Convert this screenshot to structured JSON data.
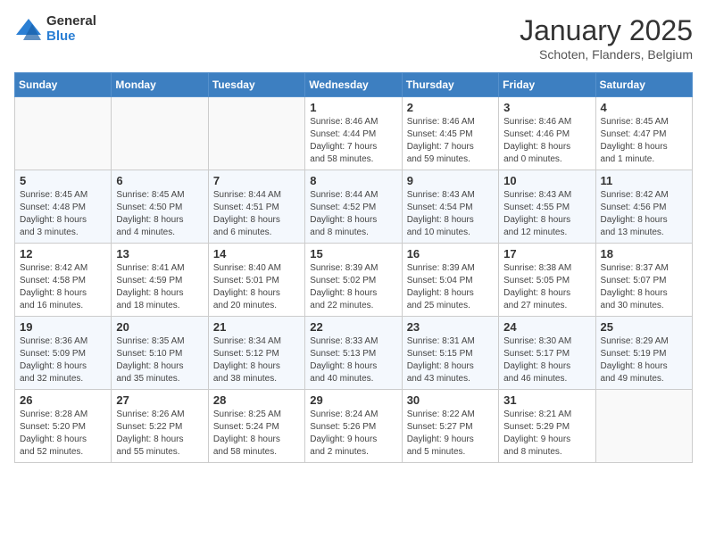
{
  "header": {
    "logo_general": "General",
    "logo_blue": "Blue",
    "month_title": "January 2025",
    "location": "Schoten, Flanders, Belgium"
  },
  "days_of_week": [
    "Sunday",
    "Monday",
    "Tuesday",
    "Wednesday",
    "Thursday",
    "Friday",
    "Saturday"
  ],
  "weeks": [
    {
      "days": [
        {
          "number": "",
          "info": ""
        },
        {
          "number": "",
          "info": ""
        },
        {
          "number": "",
          "info": ""
        },
        {
          "number": "1",
          "info": "Sunrise: 8:46 AM\nSunset: 4:44 PM\nDaylight: 7 hours\nand 58 minutes."
        },
        {
          "number": "2",
          "info": "Sunrise: 8:46 AM\nSunset: 4:45 PM\nDaylight: 7 hours\nand 59 minutes."
        },
        {
          "number": "3",
          "info": "Sunrise: 8:46 AM\nSunset: 4:46 PM\nDaylight: 8 hours\nand 0 minutes."
        },
        {
          "number": "4",
          "info": "Sunrise: 8:45 AM\nSunset: 4:47 PM\nDaylight: 8 hours\nand 1 minute."
        }
      ]
    },
    {
      "days": [
        {
          "number": "5",
          "info": "Sunrise: 8:45 AM\nSunset: 4:48 PM\nDaylight: 8 hours\nand 3 minutes."
        },
        {
          "number": "6",
          "info": "Sunrise: 8:45 AM\nSunset: 4:50 PM\nDaylight: 8 hours\nand 4 minutes."
        },
        {
          "number": "7",
          "info": "Sunrise: 8:44 AM\nSunset: 4:51 PM\nDaylight: 8 hours\nand 6 minutes."
        },
        {
          "number": "8",
          "info": "Sunrise: 8:44 AM\nSunset: 4:52 PM\nDaylight: 8 hours\nand 8 minutes."
        },
        {
          "number": "9",
          "info": "Sunrise: 8:43 AM\nSunset: 4:54 PM\nDaylight: 8 hours\nand 10 minutes."
        },
        {
          "number": "10",
          "info": "Sunrise: 8:43 AM\nSunset: 4:55 PM\nDaylight: 8 hours\nand 12 minutes."
        },
        {
          "number": "11",
          "info": "Sunrise: 8:42 AM\nSunset: 4:56 PM\nDaylight: 8 hours\nand 13 minutes."
        }
      ]
    },
    {
      "days": [
        {
          "number": "12",
          "info": "Sunrise: 8:42 AM\nSunset: 4:58 PM\nDaylight: 8 hours\nand 16 minutes."
        },
        {
          "number": "13",
          "info": "Sunrise: 8:41 AM\nSunset: 4:59 PM\nDaylight: 8 hours\nand 18 minutes."
        },
        {
          "number": "14",
          "info": "Sunrise: 8:40 AM\nSunset: 5:01 PM\nDaylight: 8 hours\nand 20 minutes."
        },
        {
          "number": "15",
          "info": "Sunrise: 8:39 AM\nSunset: 5:02 PM\nDaylight: 8 hours\nand 22 minutes."
        },
        {
          "number": "16",
          "info": "Sunrise: 8:39 AM\nSunset: 5:04 PM\nDaylight: 8 hours\nand 25 minutes."
        },
        {
          "number": "17",
          "info": "Sunrise: 8:38 AM\nSunset: 5:05 PM\nDaylight: 8 hours\nand 27 minutes."
        },
        {
          "number": "18",
          "info": "Sunrise: 8:37 AM\nSunset: 5:07 PM\nDaylight: 8 hours\nand 30 minutes."
        }
      ]
    },
    {
      "days": [
        {
          "number": "19",
          "info": "Sunrise: 8:36 AM\nSunset: 5:09 PM\nDaylight: 8 hours\nand 32 minutes."
        },
        {
          "number": "20",
          "info": "Sunrise: 8:35 AM\nSunset: 5:10 PM\nDaylight: 8 hours\nand 35 minutes."
        },
        {
          "number": "21",
          "info": "Sunrise: 8:34 AM\nSunset: 5:12 PM\nDaylight: 8 hours\nand 38 minutes."
        },
        {
          "number": "22",
          "info": "Sunrise: 8:33 AM\nSunset: 5:13 PM\nDaylight: 8 hours\nand 40 minutes."
        },
        {
          "number": "23",
          "info": "Sunrise: 8:31 AM\nSunset: 5:15 PM\nDaylight: 8 hours\nand 43 minutes."
        },
        {
          "number": "24",
          "info": "Sunrise: 8:30 AM\nSunset: 5:17 PM\nDaylight: 8 hours\nand 46 minutes."
        },
        {
          "number": "25",
          "info": "Sunrise: 8:29 AM\nSunset: 5:19 PM\nDaylight: 8 hours\nand 49 minutes."
        }
      ]
    },
    {
      "days": [
        {
          "number": "26",
          "info": "Sunrise: 8:28 AM\nSunset: 5:20 PM\nDaylight: 8 hours\nand 52 minutes."
        },
        {
          "number": "27",
          "info": "Sunrise: 8:26 AM\nSunset: 5:22 PM\nDaylight: 8 hours\nand 55 minutes."
        },
        {
          "number": "28",
          "info": "Sunrise: 8:25 AM\nSunset: 5:24 PM\nDaylight: 8 hours\nand 58 minutes."
        },
        {
          "number": "29",
          "info": "Sunrise: 8:24 AM\nSunset: 5:26 PM\nDaylight: 9 hours\nand 2 minutes."
        },
        {
          "number": "30",
          "info": "Sunrise: 8:22 AM\nSunset: 5:27 PM\nDaylight: 9 hours\nand 5 minutes."
        },
        {
          "number": "31",
          "info": "Sunrise: 8:21 AM\nSunset: 5:29 PM\nDaylight: 9 hours\nand 8 minutes."
        },
        {
          "number": "",
          "info": ""
        }
      ]
    }
  ]
}
